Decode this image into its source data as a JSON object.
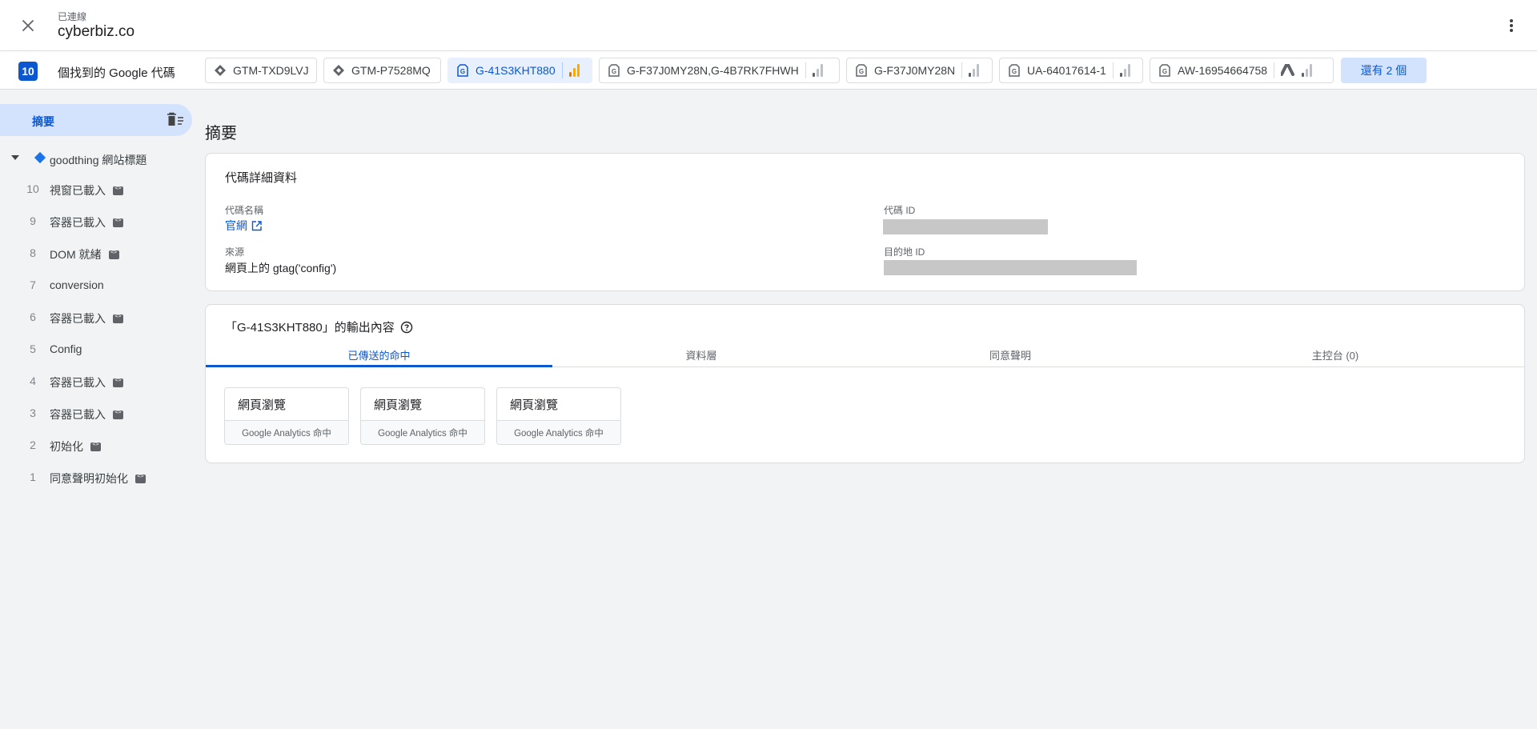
{
  "header": {
    "status": "已連線",
    "domain": "cyberbiz.co"
  },
  "tagbar": {
    "count": "10",
    "found_label": "個找到的 Google 代碼",
    "chips": [
      {
        "label": "GTM-TXD9LVJ",
        "icon": "gtm-diamond-icon"
      },
      {
        "label": "GTM-P7528MQ",
        "icon": "gtm-diamond-icon"
      },
      {
        "label": "G-41S3KHT880",
        "icon": "google-tag-icon",
        "active": true,
        "bars_icon": "analytics-bars-icon"
      },
      {
        "label": "G-F37J0MY28N,G-4B7RK7FHWH",
        "icon": "google-tag-icon",
        "bars_icon": "signal-bars-icon"
      },
      {
        "label": "G-F37J0MY28N",
        "icon": "google-tag-icon",
        "bars_icon": "signal-bars-icon"
      },
      {
        "label": "UA-64017614-1",
        "icon": "google-tag-icon",
        "bars_icon": "signal-bars-icon"
      },
      {
        "label": "AW-16954664758",
        "icon": "google-tag-icon",
        "ads_icon": "google-ads-icon",
        "bars_icon": "signal-bars-icon"
      }
    ],
    "more_label": "還有 2 個"
  },
  "sidebar": {
    "summary_label": "摘要",
    "container_label": "goodthing 網站標題",
    "events": [
      {
        "num": "10",
        "name": "視窗已載入",
        "code": true
      },
      {
        "num": "9",
        "name": "容器已載入",
        "code": true
      },
      {
        "num": "8",
        "name": "DOM 就緒",
        "code": true
      },
      {
        "num": "7",
        "name": "conversion",
        "code": false
      },
      {
        "num": "6",
        "name": "容器已載入",
        "code": true
      },
      {
        "num": "5",
        "name": "Config",
        "code": false
      },
      {
        "num": "4",
        "name": "容器已載入",
        "code": true
      },
      {
        "num": "3",
        "name": "容器已載入",
        "code": true
      },
      {
        "num": "2",
        "name": "初始化",
        "code": true
      },
      {
        "num": "1",
        "name": "同意聲明初始化",
        "code": true
      }
    ]
  },
  "main": {
    "title": "摘要",
    "details": {
      "heading": "代碼詳細資料",
      "tag_name_label": "代碼名稱",
      "tag_name_value": "官網",
      "source_label": "來源",
      "source_value": "網頁上的 gtag('config')",
      "tag_id_label": "代碼 ID",
      "dest_id_label": "目的地 ID"
    },
    "output": {
      "heading": "「G-41S3KHT880」的輸出內容",
      "tabs": [
        "已傳送的命中",
        "資料層",
        "同意聲明",
        "主控台 (0)"
      ],
      "hits": [
        {
          "title": "網頁瀏覽",
          "sub": "Google Analytics 命中"
        },
        {
          "title": "網頁瀏覽",
          "sub": "Google Analytics 命中"
        },
        {
          "title": "網頁瀏覽",
          "sub": "Google Analytics 命中"
        }
      ]
    }
  },
  "colors": {
    "accent": "#0b57d0",
    "analytics_orange": "#f9ab00",
    "analytics_dark_orange": "#e37400",
    "redacted_gray": "#c7c7c7"
  }
}
